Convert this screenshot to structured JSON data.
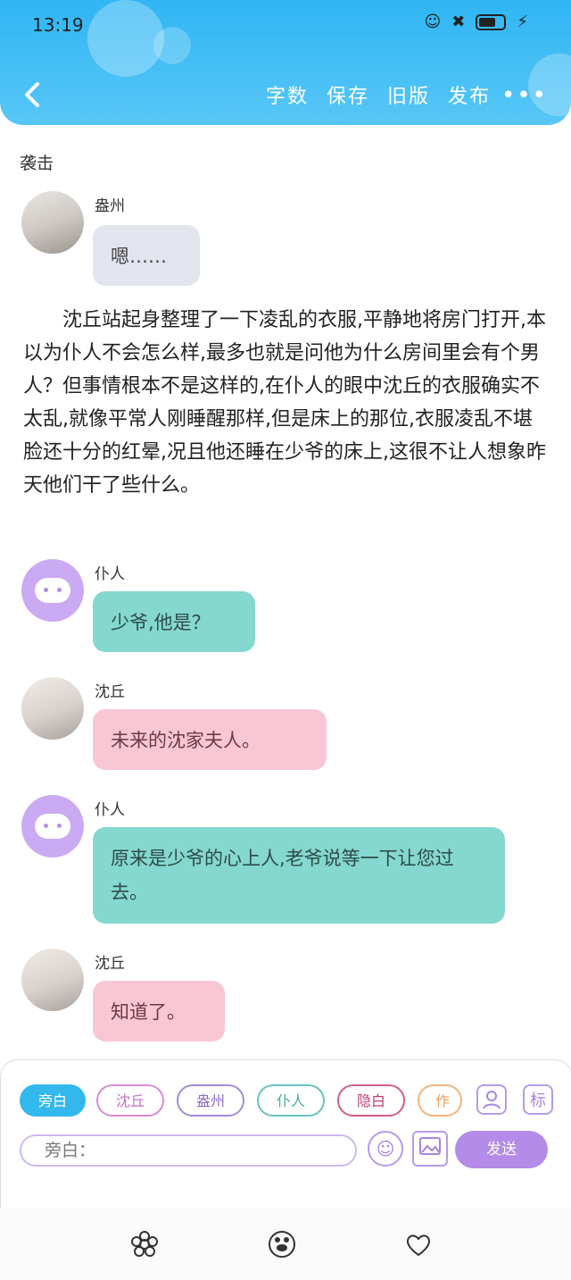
{
  "status_bar": {
    "time": "13:19"
  },
  "header": {
    "actions": [
      "字数",
      "保存",
      "旧版",
      "发布"
    ],
    "more": "•••"
  },
  "chapter": {
    "title": "袭击"
  },
  "messages": [
    {
      "speaker": "盎州",
      "text": "嗯……"
    },
    {
      "speaker": "仆人",
      "text": "少爷,他是？"
    },
    {
      "speaker": "沈丘",
      "text": "未来的沈家夫人。"
    },
    {
      "speaker": "仆人",
      "text": "原来是少爷的心上人,老爷说等一下让您过去。"
    },
    {
      "speaker": "沈丘",
      "text": "知道了。"
    }
  ],
  "narration": "沈丘站起身整理了一下凌乱的衣服,平静地将房门打开,本以为仆人不会怎么样,最多也就是问他为什么房间里会有个男人？但事情根本不是这样的,在仆人的眼中沈丘的衣服确实不太乱,就像平常人刚睡醒那样,但是床上的那位,衣服凌乱不堪脸还十分的红晕,况且他还睡在少爷的床上,这很不让人想象昨天他们干了些什么。",
  "composer": {
    "chips": [
      "旁白",
      "沈丘",
      "盎州",
      "仆人",
      "隐白",
      "作者"
    ],
    "mini_buttons": [
      "标"
    ],
    "input_placeholder": "旁白：",
    "send_label": "发送"
  }
}
